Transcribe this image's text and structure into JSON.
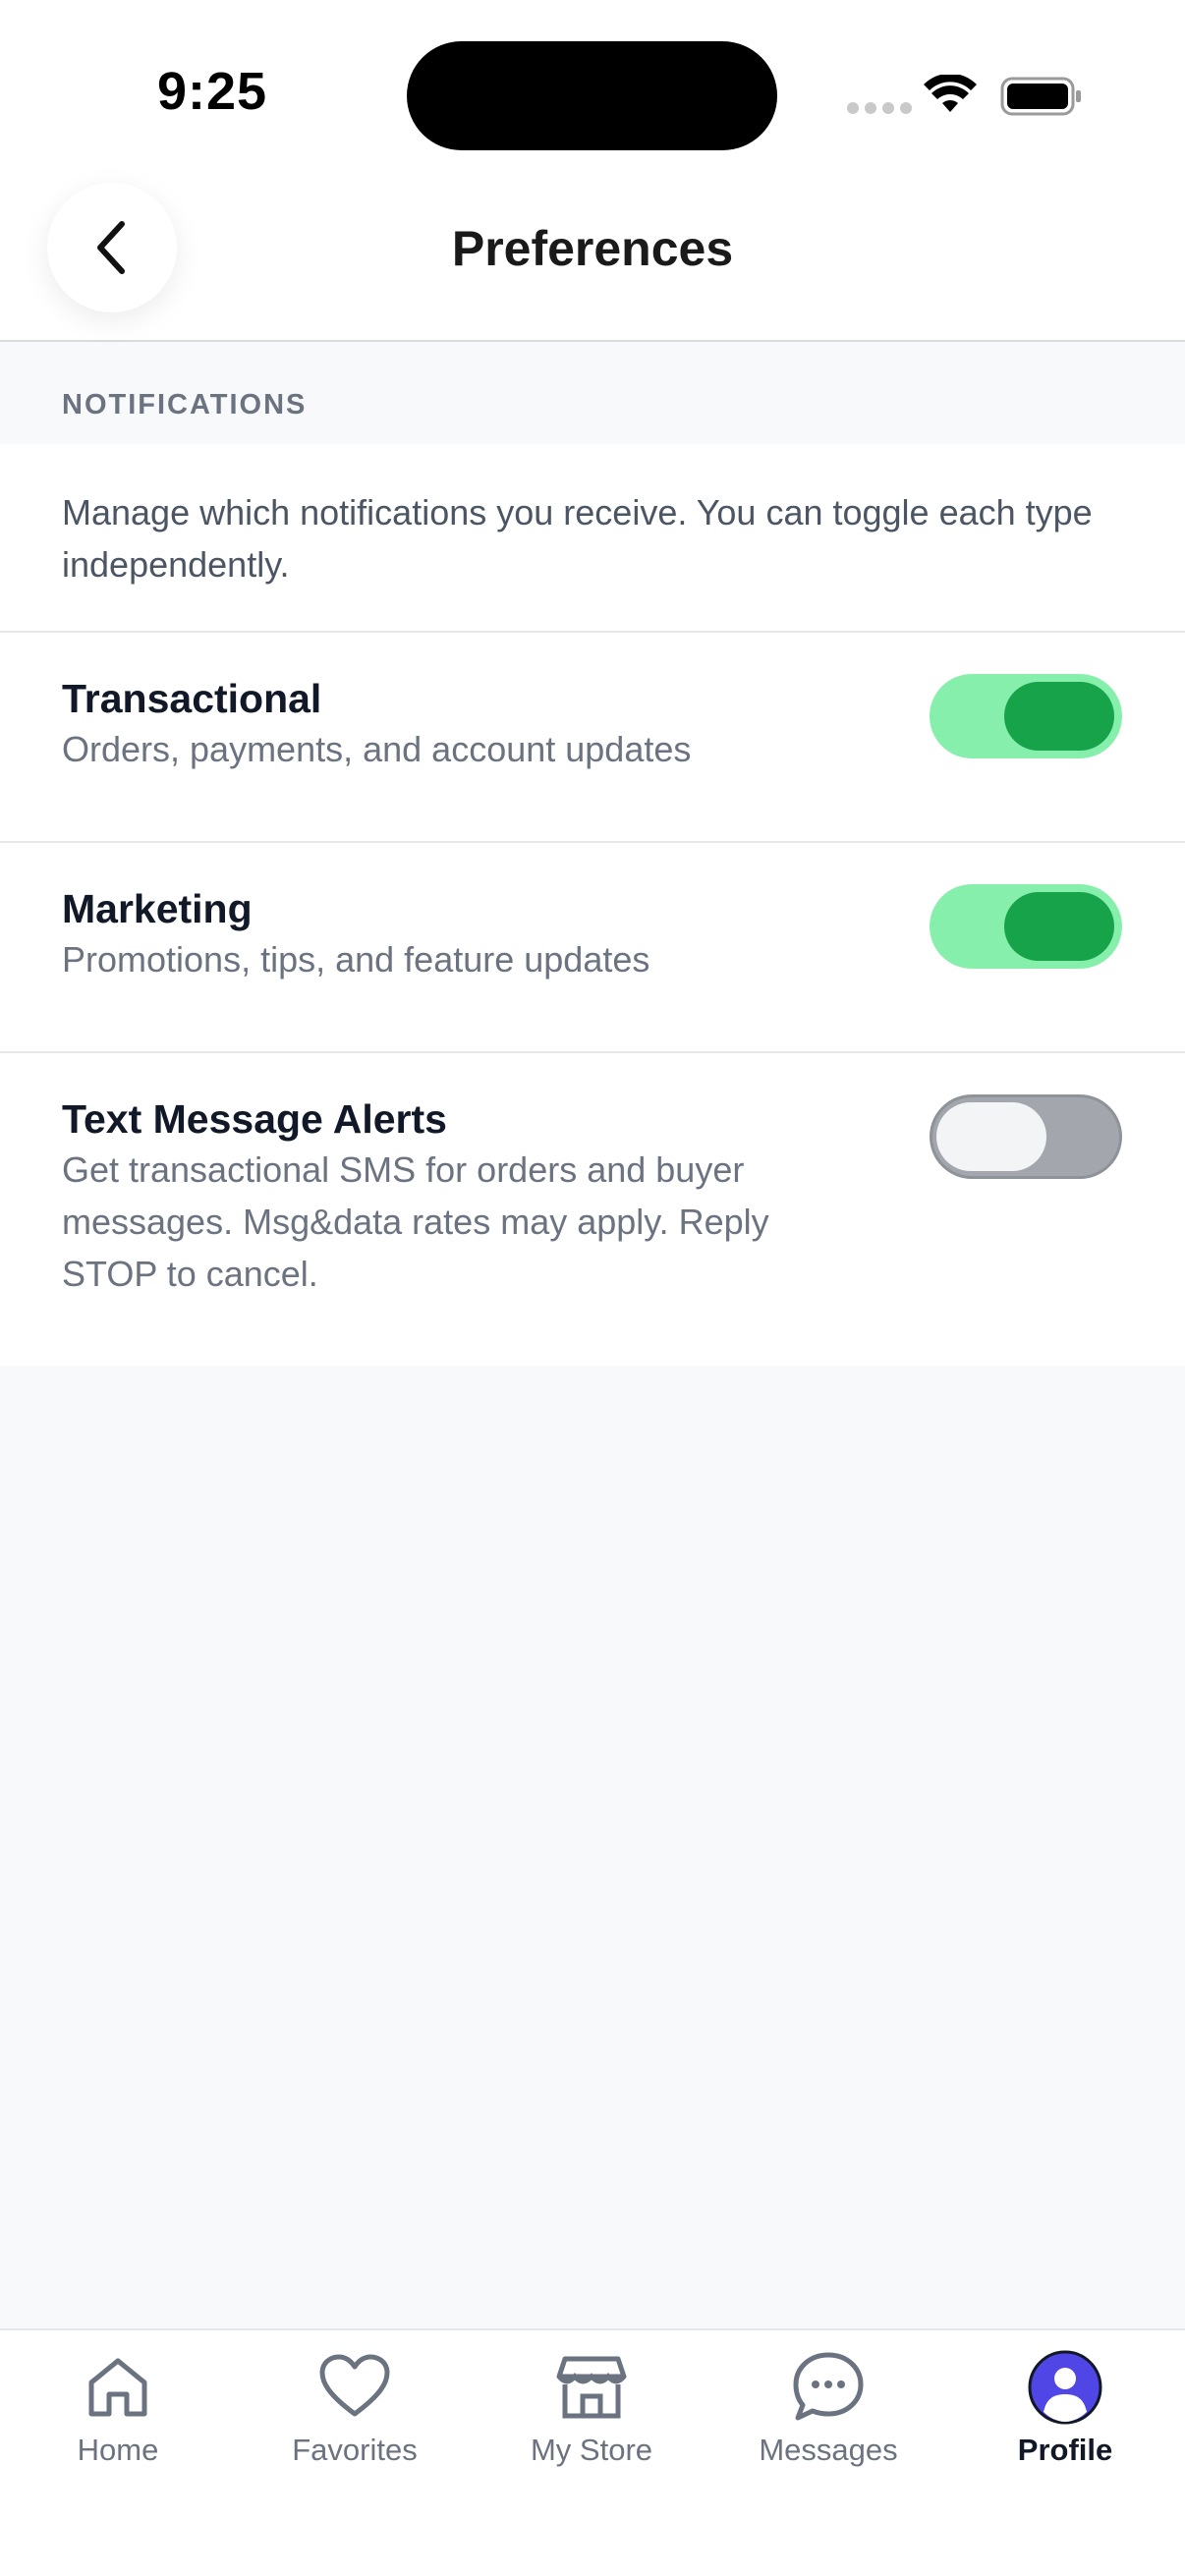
{
  "status_bar": {
    "time": "9:25"
  },
  "header": {
    "title": "Preferences",
    "back_icon": "chevron-left-icon"
  },
  "section": {
    "label": "NOTIFICATIONS"
  },
  "intro": "Manage which notifications you receive. You can toggle each type independently.",
  "preferences": [
    {
      "title": "Transactional",
      "description": "Orders, payments, and account updates",
      "enabled": true
    },
    {
      "title": "Marketing",
      "description": "Promotions, tips, and feature updates",
      "enabled": true
    },
    {
      "title": "Text Message Alerts",
      "description": "Get transactional SMS for orders and buyer messages. Msg&data rates may apply. Reply STOP to cancel.",
      "enabled": false
    }
  ],
  "colors": {
    "toggle_on_track": "#86efac",
    "toggle_on_knob": "#16a34a",
    "toggle_off_track": "#a3a7ad",
    "avatar": "#4f46e5"
  },
  "tab_bar": {
    "tabs": [
      {
        "label": "Home",
        "icon": "home-icon",
        "active": false
      },
      {
        "label": "Favorites",
        "icon": "heart-icon",
        "active": false
      },
      {
        "label": "My Store",
        "icon": "store-icon",
        "active": false
      },
      {
        "label": "Messages",
        "icon": "chat-bubble-icon",
        "active": false
      },
      {
        "label": "Profile",
        "icon": "avatar-icon",
        "active": true
      }
    ]
  }
}
